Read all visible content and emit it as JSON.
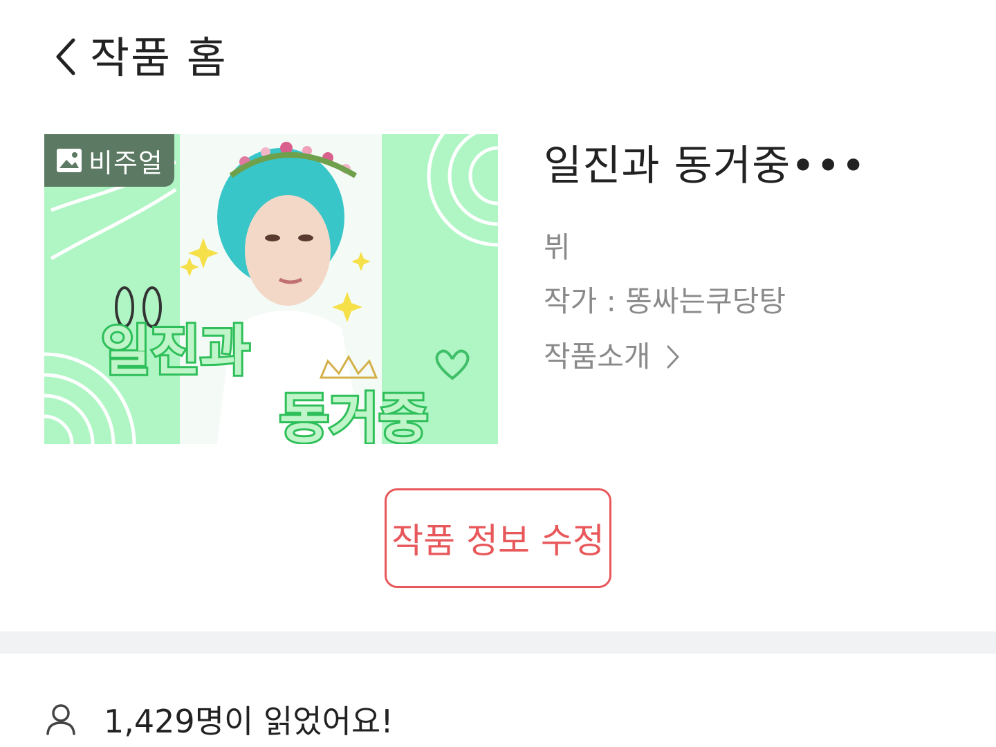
{
  "header": {
    "back_icon": "chevron-left-icon",
    "title": "작품 홈"
  },
  "cover": {
    "badge_icon": "image-icon",
    "badge_label": "비주얼",
    "art_line1": "일진과",
    "art_line2": "동거중",
    "background_color": "#b0f6c5"
  },
  "work": {
    "title": "일진과 동거중•••",
    "tag": "뷔",
    "author": "작가 : 똥싸는쿠당탕",
    "intro_label": "작품소개"
  },
  "actions": {
    "edit_label": "작품 정보 수정",
    "accent_color": "#e8575a"
  },
  "stats": {
    "reader_icon": "person-icon",
    "readers_text": "1,429명이 읽었어요!"
  }
}
